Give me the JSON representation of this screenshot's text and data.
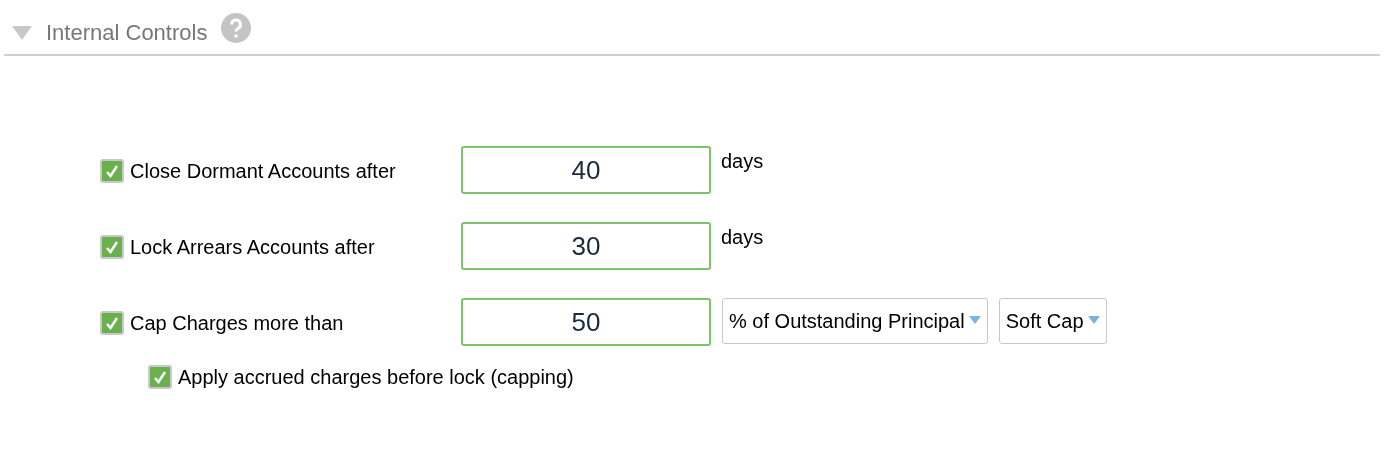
{
  "section": {
    "title": "Internal Controls",
    "expanded": true
  },
  "rows": [
    {
      "kind": "unit",
      "checked": true,
      "label": "Close Dormant Accounts after",
      "value": "40",
      "unit": "days"
    },
    {
      "kind": "unit",
      "checked": true,
      "label": "Lock Arrears Accounts after",
      "value": "30",
      "unit": "days"
    },
    {
      "kind": "selects",
      "checked": true,
      "label": "Cap Charges more than",
      "value": "50",
      "selects": [
        "% of Outstanding Principal",
        "Soft Cap"
      ]
    }
  ],
  "sub_option": {
    "checked": true,
    "label": "Apply accrued charges before lock (capping)"
  }
}
